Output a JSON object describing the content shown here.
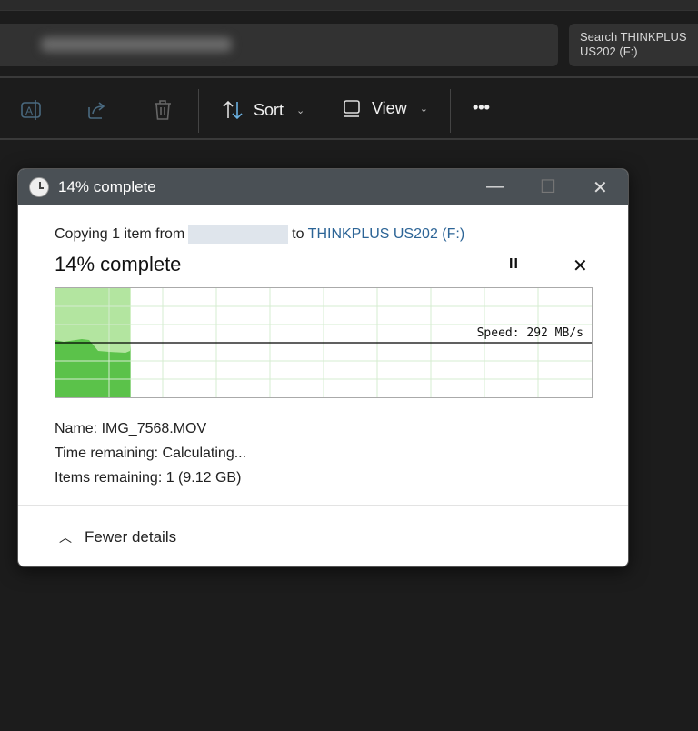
{
  "explorer": {
    "search_placeholder": "Search THINKPLUS US202 (F:)",
    "sort_label": "Sort",
    "view_label": "View",
    "more_label": "•••"
  },
  "dialog": {
    "window_title": "14% complete",
    "copy_prefix": "Copying 1 item from",
    "copy_to": "to",
    "destination": "THINKPLUS US202 (F:)",
    "heading": "14% complete",
    "pause_label": "II",
    "cancel_label": "✕",
    "progress_percent": 14,
    "speed_label": "Speed: 292 MB/s",
    "name_line": "Name:  IMG_7568.MOV",
    "time_line": "Time remaining:  Calculating...",
    "items_line": "Items remaining:  1 (9.12 GB)",
    "fewer_details": "Fewer details",
    "colors": {
      "progress_light": "#b3e5a0",
      "throughput": "#5bc24a",
      "grid": "#d5ecd0"
    }
  }
}
